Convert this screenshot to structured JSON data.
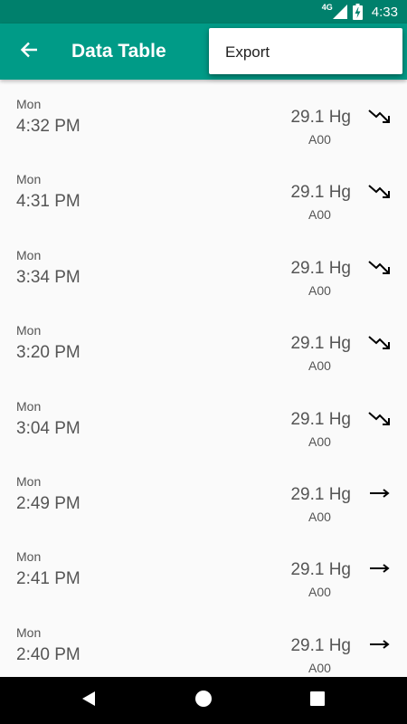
{
  "status_bar": {
    "network": "4G",
    "time": "4:33"
  },
  "app_bar": {
    "title": "Data Table",
    "back_icon": "arrow-left-icon"
  },
  "menu": {
    "items": [
      {
        "label": "Export"
      }
    ]
  },
  "rows": [
    {
      "day": "Mon",
      "time": "4:32 PM",
      "value": "29.1 Hg",
      "code": "A00",
      "trend": "falling"
    },
    {
      "day": "Mon",
      "time": "4:31 PM",
      "value": "29.1 Hg",
      "code": "A00",
      "trend": "falling"
    },
    {
      "day": "Mon",
      "time": "3:34 PM",
      "value": "29.1 Hg",
      "code": "A00",
      "trend": "falling"
    },
    {
      "day": "Mon",
      "time": "3:20 PM",
      "value": "29.1 Hg",
      "code": "A00",
      "trend": "falling"
    },
    {
      "day": "Mon",
      "time": "3:04 PM",
      "value": "29.1 Hg",
      "code": "A00",
      "trend": "falling"
    },
    {
      "day": "Mon",
      "time": "2:49 PM",
      "value": "29.1 Hg",
      "code": "A00",
      "trend": "steady"
    },
    {
      "day": "Mon",
      "time": "2:41 PM",
      "value": "29.1 Hg",
      "code": "A00",
      "trend": "steady"
    },
    {
      "day": "Mon",
      "time": "2:40 PM",
      "value": "29.1 Hg",
      "code": "A00",
      "trend": "steady"
    }
  ],
  "nav_bar": {
    "buttons": [
      "back-triangle-icon",
      "home-circle-icon",
      "recents-square-icon"
    ]
  },
  "colors": {
    "status_bar": "#00806c",
    "app_bar": "#009b87",
    "text_secondary": "#555555"
  }
}
